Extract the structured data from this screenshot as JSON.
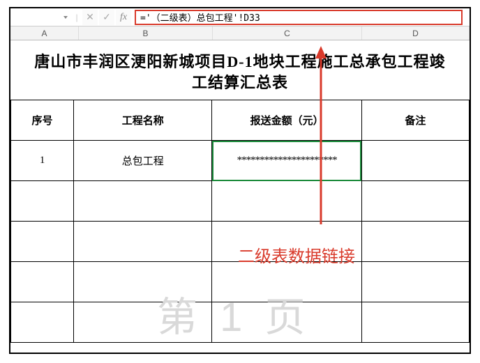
{
  "formula_bar": {
    "formula_text": "='（二级表）总包工程'!D33",
    "fx_label": "fx",
    "cancel_icon": "✕",
    "confirm_icon": "✓"
  },
  "columns": {
    "a": "A",
    "b": "B",
    "c": "C",
    "d": "D"
  },
  "title": "唐山市丰润区浭阳新城项目D-1地块工程施工总承包工程竣工结算汇总表",
  "headers": {
    "seq": "序号",
    "name": "工程名称",
    "amount": "报送金额（元）",
    "remark": "备注"
  },
  "rows": [
    {
      "seq": "1",
      "name": "总包工程",
      "amount": "**********************",
      "remark": ""
    },
    {
      "seq": "",
      "name": "",
      "amount": "",
      "remark": ""
    },
    {
      "seq": "",
      "name": "",
      "amount": "",
      "remark": ""
    },
    {
      "seq": "",
      "name": "",
      "amount": "",
      "remark": ""
    },
    {
      "seq": "",
      "name": "",
      "amount": "",
      "remark": ""
    }
  ],
  "annotation": "二级表数据链接",
  "watermark": "第 1 页"
}
